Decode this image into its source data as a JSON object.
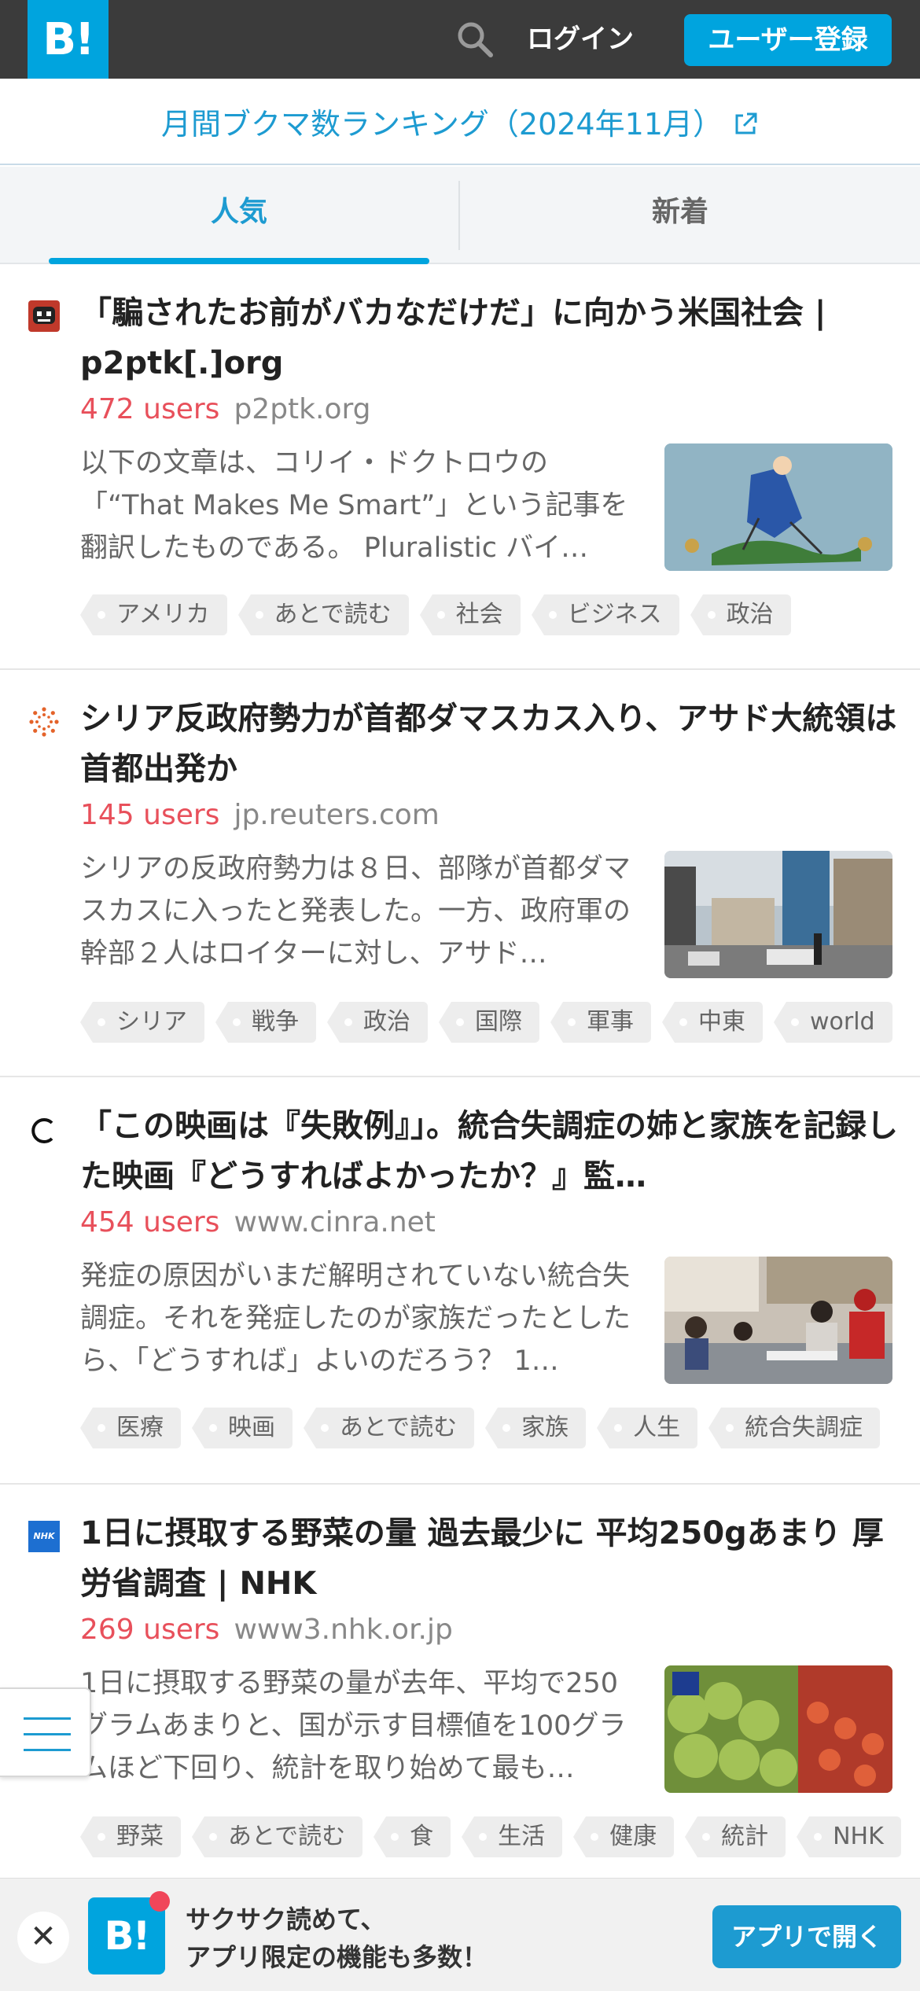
{
  "header": {
    "logo_text": "B!",
    "search_icon": "search-icon",
    "login_label": "ログイン",
    "register_label": "ユーザー登録"
  },
  "ranking": {
    "title": "月間ブクマ数ランキング（2024年11月）",
    "link_icon": "external-link-icon"
  },
  "tabs": [
    {
      "label": "人気",
      "active": true
    },
    {
      "label": "新着",
      "active": false
    }
  ],
  "entries": [
    {
      "title": "「騙されたお前がバカなだけだ」に向かう米国社会 | p2ptk[.]org",
      "users": "472 users",
      "domain": "p2ptk.org",
      "description": "以下の文章は、コリイ・ドクトロウの「“That Makes Me Smart”」という記事を翻訳したものである。 Pluralistic バイ…",
      "tags": [
        "アメリカ",
        "あとで読む",
        "社会",
        "ビジネス",
        "政治"
      ]
    },
    {
      "title": "シリア反政府勢力が首都ダマスカス入り、アサド大統領は首都出発か",
      "users": "145 users",
      "domain": "jp.reuters.com",
      "description": "シリアの反政府勢力は８日、部隊が首都ダマスカスに入ったと発表した。一方、政府軍の幹部２人はロイターに対し、アサド…",
      "tags": [
        "シリア",
        "戦争",
        "政治",
        "国際",
        "軍事",
        "中東",
        "world"
      ]
    },
    {
      "title": "「この映画は『失敗例』」。統合失調症の姉と家族を記録した映画『どうすればよかったか？』監…",
      "users": "454 users",
      "domain": "www.cinra.net",
      "description": "発症の原因がいまだ解明されていない統合失調症。それを発症したのが家族だったとしたら、「どうすれば」よいのだろう？ 1…",
      "tags": [
        "医療",
        "映画",
        "あとで読む",
        "家族",
        "人生",
        "統合失調症"
      ]
    },
    {
      "title": "1日に摂取する野菜の量 過去最少に 平均250gあまり 厚労省調査 | NHK",
      "users": "269 users",
      "domain": "www3.nhk.or.jp",
      "description": "1日に摂取する野菜の量が去年、平均で250グラムあまりと、国が示す目標値を100グラムほど下回り、統計を取り始めて最も…",
      "tags": [
        "野菜",
        "あとで読む",
        "食",
        "生活",
        "健康",
        "統計",
        "NHK"
      ],
      "favicon_text": "NHK"
    }
  ],
  "menu_icon": "hamburger-menu-icon",
  "app_banner": {
    "close_label": "✕",
    "logo_text": "B!",
    "line1": "サクサク読めて、",
    "line2": "アプリ限定の機能も多数！",
    "open_label": "アプリで開く"
  },
  "colors": {
    "brand": "#00a4de",
    "header_bg": "#3b3b3b",
    "users": "#e8505b",
    "link": "#1d9bd1"
  }
}
